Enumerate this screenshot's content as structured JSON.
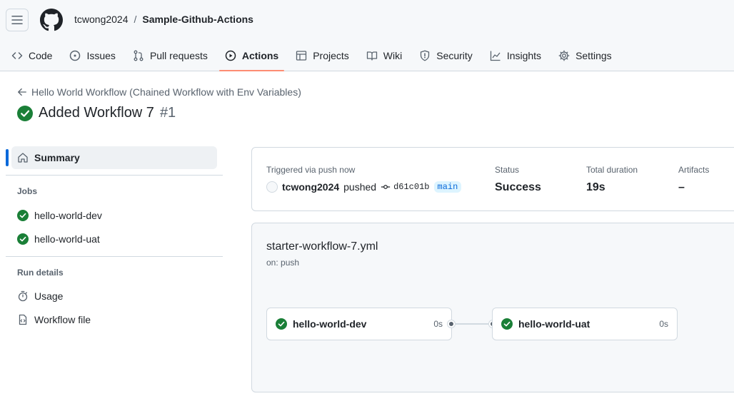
{
  "repo": {
    "owner": "tcwong2024",
    "sep": "/",
    "name": "Sample-Github-Actions"
  },
  "tabs": [
    {
      "label": "Code",
      "icon": "code-icon"
    },
    {
      "label": "Issues",
      "icon": "issue-icon"
    },
    {
      "label": "Pull requests",
      "icon": "pull-request-icon"
    },
    {
      "label": "Actions",
      "icon": "play-icon",
      "active": true
    },
    {
      "label": "Projects",
      "icon": "table-icon"
    },
    {
      "label": "Wiki",
      "icon": "book-icon"
    },
    {
      "label": "Security",
      "icon": "shield-icon"
    },
    {
      "label": "Insights",
      "icon": "graph-icon"
    },
    {
      "label": "Settings",
      "icon": "gear-icon"
    }
  ],
  "run": {
    "workflow_link": "Hello World Workflow (Chained Workflow with Env Variables)",
    "title": "Added Workflow 7",
    "number": "#1"
  },
  "sidebar": {
    "summary": "Summary",
    "jobs_heading": "Jobs",
    "jobs": [
      "hello-world-dev",
      "hello-world-uat"
    ],
    "details_heading": "Run details",
    "usage": "Usage",
    "workflow_file": "Workflow file"
  },
  "summary_card": {
    "trigger_label": "Triggered via push now",
    "actor": "tcwong2024",
    "action": "pushed",
    "sha": "d61c01b",
    "branch": "main",
    "status_label": "Status",
    "status": "Success",
    "duration_label": "Total duration",
    "duration": "19s",
    "artifacts_label": "Artifacts",
    "artifacts": "–"
  },
  "graph": {
    "file": "starter-workflow-7.yml",
    "trigger": "on: push",
    "jobs": [
      {
        "name": "hello-world-dev",
        "duration": "0s"
      },
      {
        "name": "hello-world-uat",
        "duration": "0s"
      }
    ]
  },
  "colors": {
    "success": "#1a7f37",
    "accent": "#0969da",
    "tab_underline": "#fd8c73"
  }
}
